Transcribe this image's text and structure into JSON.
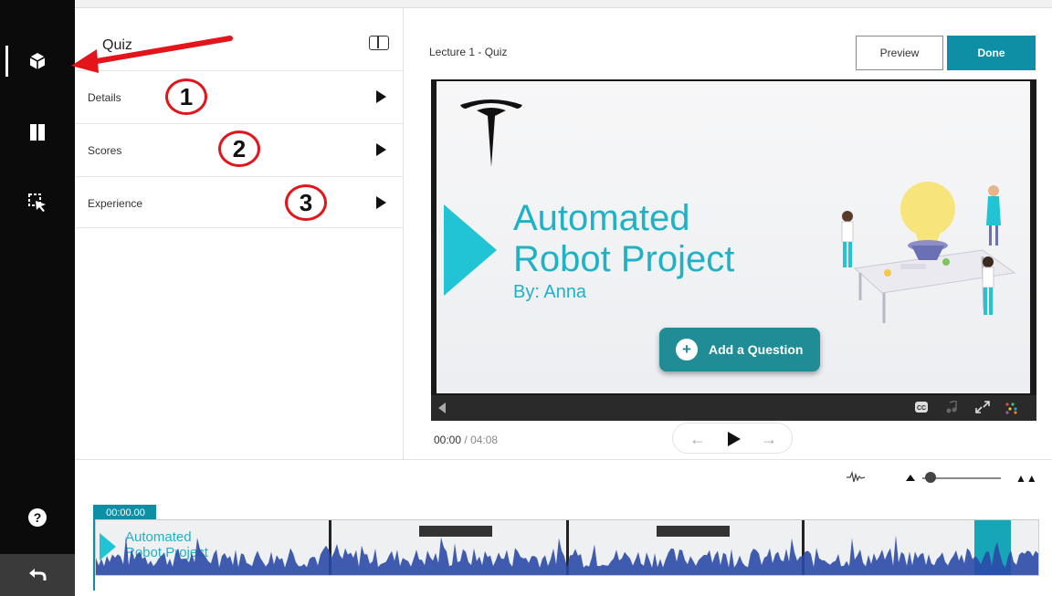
{
  "panel": {
    "title": "Quiz",
    "rows": [
      {
        "label": "Details",
        "annotation": "1"
      },
      {
        "label": "Scores",
        "annotation": "2"
      },
      {
        "label": "Experience",
        "annotation": "3"
      }
    ]
  },
  "main": {
    "title": "Lecture 1 - Quiz",
    "preview_label": "Preview",
    "done_label": "Done"
  },
  "slide": {
    "title_line1": "Automated",
    "title_line2": "Robot Project",
    "byline": "By: Anna",
    "add_question_label": "Add a Question"
  },
  "player": {
    "current_time": "00:00",
    "separator": "/",
    "total_time": "04:08"
  },
  "timeline": {
    "playhead_time": "00:00.00",
    "thumb_title_line1": "Automated",
    "thumb_title_line2": "Robot Project"
  },
  "colors": {
    "accent": "#0f8fa6",
    "slide_teal": "#1fb2c7",
    "annotation_red": "#e3141a",
    "rail_bg": "#0b0b0b"
  },
  "icons": {
    "rail": [
      "cube-icon",
      "book-icon",
      "cursor-select-icon",
      "help-icon",
      "undo-icon"
    ]
  }
}
